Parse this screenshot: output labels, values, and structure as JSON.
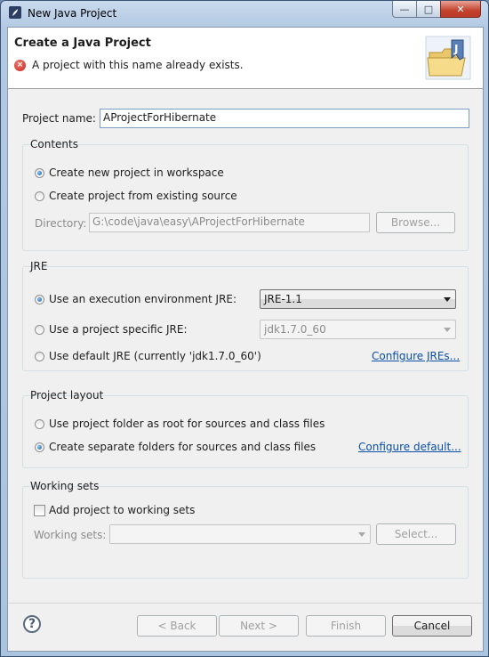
{
  "window": {
    "title": "New Java Project",
    "controls": {
      "minimize": "—",
      "maximize": "□",
      "close": "✕"
    }
  },
  "banner": {
    "title": "Create a Java Project",
    "message": "A project with this name already exists.",
    "error_icon": "×"
  },
  "project_name": {
    "label": "Project name:",
    "value": "AProjectForHibernate"
  },
  "contents": {
    "title": "Contents",
    "options": [
      "Create new project in workspace",
      "Create project from existing source"
    ],
    "selected": 0,
    "directory_label": "Directory:",
    "directory_value": "G:\\code\\java\\easy\\AProjectForHibernate",
    "browse_label": "Browse..."
  },
  "jre": {
    "title": "JRE",
    "options": [
      "Use an execution environment JRE:",
      "Use a project specific JRE:",
      "Use default JRE (currently 'jdk1.7.0_60')"
    ],
    "selected": 0,
    "env_value": "JRE-1.1",
    "specific_value": "jdk1.7.0_60",
    "configure_link": "Configure JREs..."
  },
  "layout": {
    "title": "Project layout",
    "options": [
      "Use project folder as root for sources and class files",
      "Create separate folders for sources and class files"
    ],
    "selected": 1,
    "configure_link": "Configure default..."
  },
  "working_sets": {
    "title": "Working sets",
    "checkbox_label": "Add project to working sets",
    "checked": false,
    "sets_label": "Working sets:",
    "sets_value": "",
    "select_label": "Select..."
  },
  "footer": {
    "help": "?",
    "back": "< Back",
    "next": "Next >",
    "finish": "Finish",
    "cancel": "Cancel"
  },
  "colors": {
    "link": "#0a4fa8",
    "error": "#c8231a",
    "disabled_text": "#8c8c8c"
  }
}
